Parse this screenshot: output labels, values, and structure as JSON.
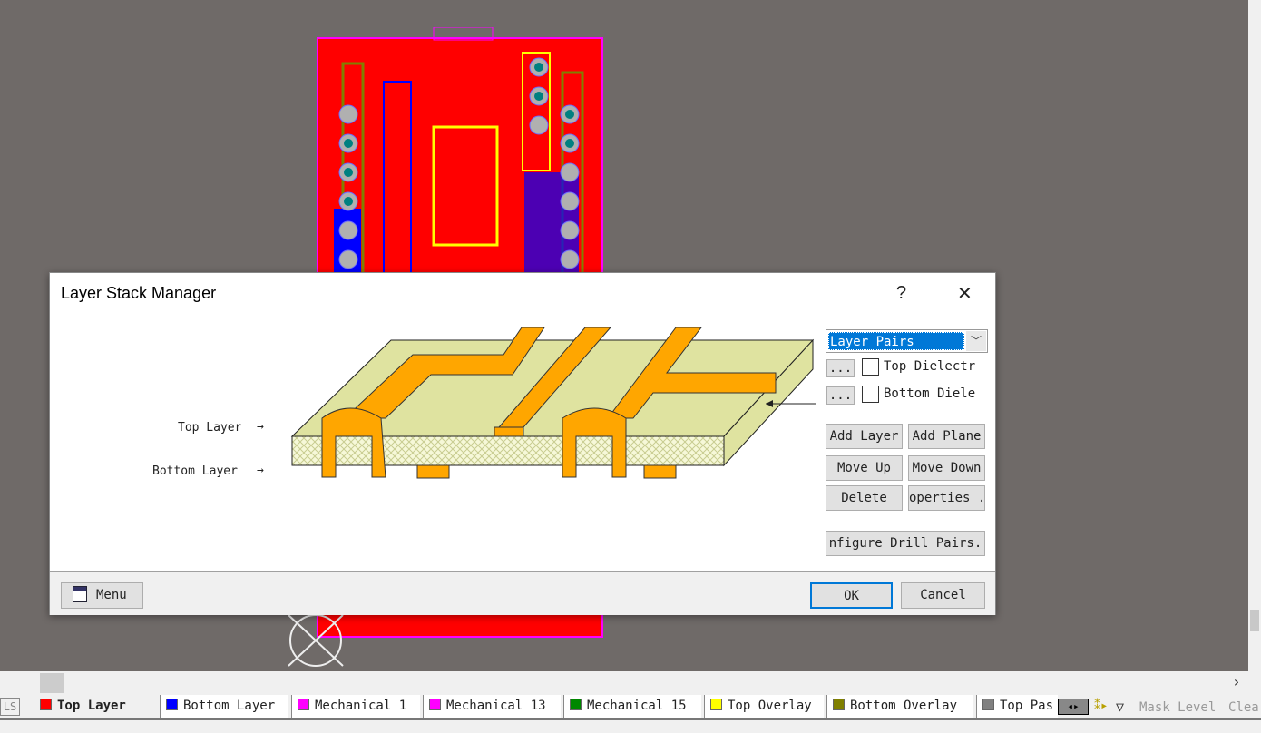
{
  "dialog": {
    "title": "Layer Stack Manager",
    "help_label": "?",
    "close_label": "✕",
    "combo_value": "Layer Pairs",
    "top_dielectric_label": "Top Dielectr",
    "bottom_dielectric_label": "Bottom Diele",
    "ellipsis_label": "...",
    "add_layer": "Add Layer",
    "add_plane": "Add Plane",
    "move_up": "Move Up",
    "move_down": "Move Down",
    "delete": "Delete",
    "properties": "operties .",
    "configure_drill": "nfigure Drill Pairs.",
    "top_layer_label": "Top Layer",
    "bottom_layer_label": "Bottom Layer",
    "menu_label": "Menu",
    "ok_label": "OK",
    "cancel_label": "Cancel"
  },
  "layer_tabs": {
    "ls_label": "LS",
    "items": [
      {
        "label": "Top Layer",
        "color": "#ff0000",
        "active": true
      },
      {
        "label": "Bottom Layer",
        "color": "#0000ff"
      },
      {
        "label": "Mechanical 1",
        "color": "#ff00ff"
      },
      {
        "label": "Mechanical 13",
        "color": "#ff00ff"
      },
      {
        "label": "Mechanical 15",
        "color": "#008000"
      },
      {
        "label": "Top Overlay",
        "color": "#ffff00"
      },
      {
        "label": "Bottom Overlay",
        "color": "#808000"
      },
      {
        "label": "Top Pas",
        "color": "#808080"
      }
    ],
    "mask_level": "Mask Level",
    "clear": "Clea"
  },
  "colors": {
    "background": "#6f6a68",
    "board": "#ff0000",
    "accent": "#0078d7",
    "trace": "#ffa500"
  }
}
